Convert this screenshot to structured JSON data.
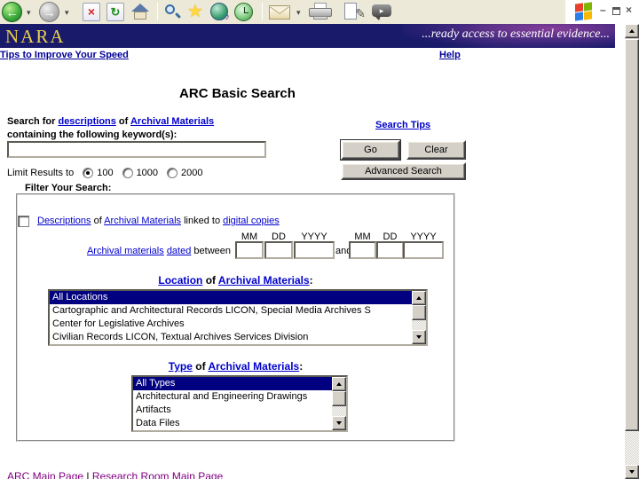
{
  "browser": {
    "toolbar_icons": [
      "back",
      "back-dropdown",
      "forward",
      "forward-dropdown",
      "stop",
      "refresh",
      "home",
      "search",
      "favorites",
      "media",
      "history",
      "mail",
      "mail-dropdown",
      "print",
      "edit",
      "discuss"
    ],
    "window_controls": [
      "minimize",
      "restore",
      "close"
    ]
  },
  "masthead": {
    "logo": "NARA",
    "tagline": "...ready access to essential evidence..."
  },
  "quicklinks": {
    "tips": "Tips to Improve Your Speed",
    "help": "Help"
  },
  "search": {
    "title": "ARC Basic Search",
    "intro": {
      "t1": "Search for ",
      "link1": "descriptions",
      "t2": " of ",
      "link2": "Archival Materials",
      "line2": "containing the following keyword(s):"
    },
    "tips_link": "Search Tips",
    "keyword_value": "",
    "go": "Go",
    "clear": "Clear",
    "advanced": "Advanced Search",
    "limit": {
      "label": "Limit Results to",
      "options": [
        "100",
        "1000",
        "2000"
      ],
      "selected": "100"
    }
  },
  "filters": {
    "heading": "Filter Your Search:",
    "digital": {
      "link1": "Descriptions",
      "t1": " of ",
      "link2": "Archival Materials",
      "t2": " linked to ",
      "link3": "digital copies",
      "checked": false
    },
    "date": {
      "link1": "Archival materials",
      "link2": "dated",
      "t2": " between",
      "and": "and",
      "labels": [
        "MM",
        "DD",
        "YYYY"
      ],
      "values": [
        "",
        "",
        "",
        "",
        "",
        ""
      ]
    },
    "location": {
      "head_link1": "Location",
      "head_t": " of ",
      "head_link2": "Archival Materials",
      "colon": ":",
      "items": [
        "All Locations",
        "Cartographic and Architectural Records LICON, Special Media Archives S",
        "Center for Legislative Archives",
        "Civilian Records LICON, Textual Archives Services Division"
      ],
      "selected": "All Locations"
    },
    "type": {
      "head_link1": "Type",
      "head_t": " of ",
      "head_link2": "Archival Materials",
      "colon": ":",
      "items": [
        "All Types",
        "Architectural and Engineering Drawings",
        "Artifacts",
        "Data Files"
      ],
      "selected": "All Types"
    }
  },
  "footer": {
    "link1": "ARC Main Page",
    "sep": " | ",
    "link2": "Research Room Main Page"
  },
  "colors": {
    "masthead_navy": "#1a1a6b",
    "logo_gold": "#e8cf4e",
    "link_blue": "#0000cc",
    "nav_link_navy": "#000099",
    "visited_purple": "#800080",
    "selection_navy": "#000080",
    "toolbar_gray": "#ece9d8",
    "button_face": "#d4d0c8"
  }
}
